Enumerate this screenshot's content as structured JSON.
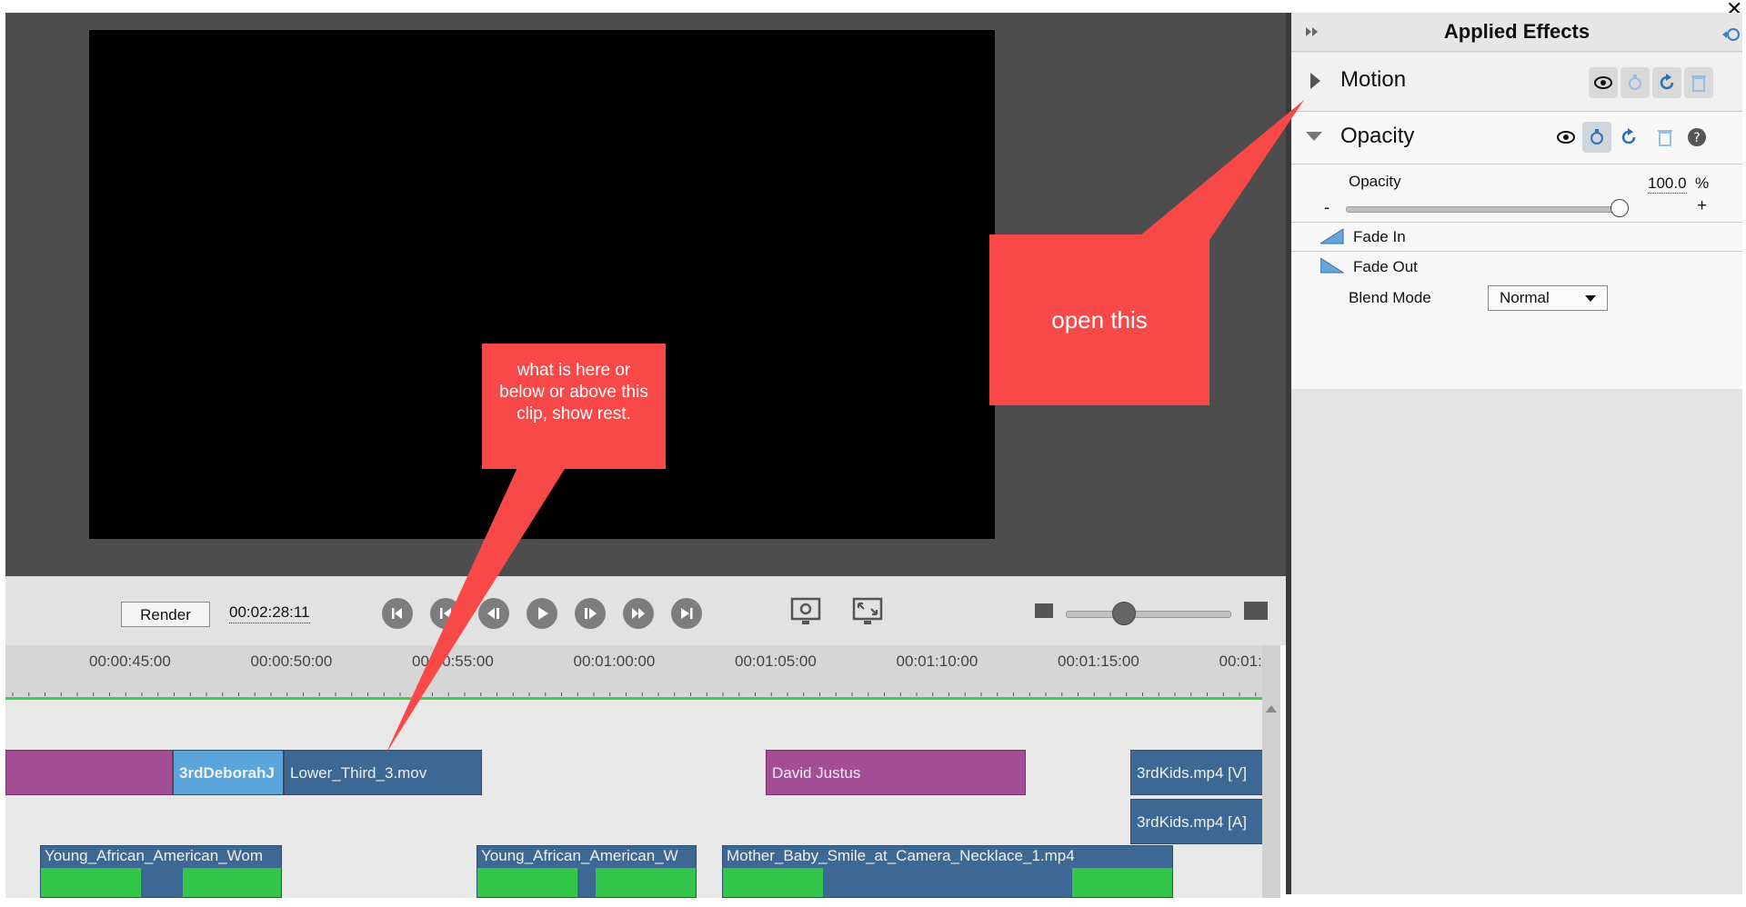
{
  "monitor": {
    "preview": ""
  },
  "transport": {
    "render_label": "Render",
    "timecode": "00:02:28:11",
    "buttons": [
      "go-to-start",
      "step-back",
      "frame-back",
      "play",
      "frame-forward",
      "step-forward",
      "go-to-end"
    ],
    "icons": [
      "render-settings-icon",
      "fullscreen-icon"
    ],
    "zoom_value": 0.35
  },
  "timeline": {
    "ruler_labels": [
      "00:00:45:00",
      "00:00:50:00",
      "00:00:55:00",
      "00:01:00:00",
      "00:01:05:00",
      "00:01:10:00",
      "00:01:15:00",
      "00:01:"
    ],
    "track1": {
      "clip_a": "",
      "clip_b": "3rdDeborahJ",
      "clip_c": "Lower_Third_3.mov",
      "clip_d": "David Justus",
      "clip_e": "3rdKids.mp4 [V]"
    },
    "track2": {
      "clip_a": "3rdKids.mp4 [A]"
    },
    "track3": {
      "clip_a": "Young_African_American_Wom",
      "clip_b": "Young_African_American_W",
      "clip_c": "Mother_Baby_Smile_at_Camera_Necklace_1.mp4"
    }
  },
  "panel": {
    "title": "Applied Effects",
    "motion": {
      "title": "Motion",
      "icons": [
        "visibility-icon",
        "keyframe-icon",
        "reset-icon",
        "delete-icon"
      ]
    },
    "opacity": {
      "title": "Opacity",
      "icons": [
        "visibility-icon",
        "keyframe-icon",
        "reset-icon",
        "delete-icon",
        "help-icon"
      ],
      "param_label": "Opacity",
      "param_value": "100.0",
      "param_unit": "%",
      "slider_value": 1.0,
      "minus": "-",
      "plus": "+",
      "fade_in": "Fade In",
      "fade_out": "Fade Out",
      "blend_label": "Blend Mode",
      "blend_value": "Normal"
    }
  },
  "annotations": {
    "callout_right": "open this",
    "callout_center": "what is here or below or above this clip, show rest."
  },
  "colors": {
    "callout": "#f84848",
    "clip_purple": "#a34d94",
    "clip_blue": "#3d6893",
    "clip_light_blue": "#5aa6dc",
    "playhead_green": "#3fcf4f"
  }
}
